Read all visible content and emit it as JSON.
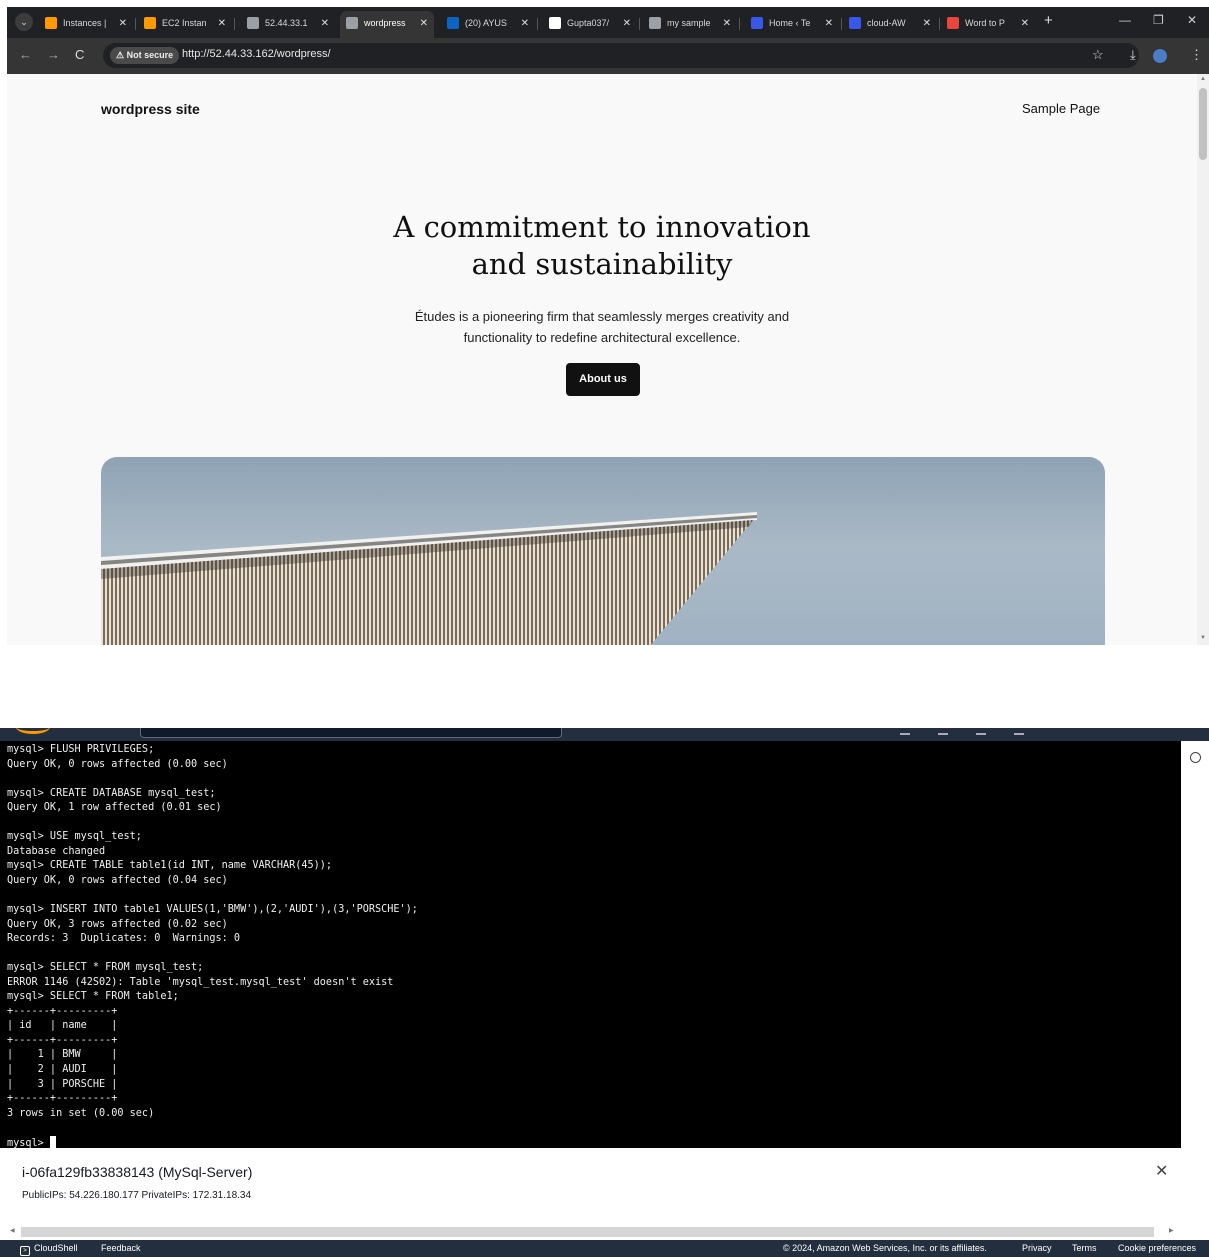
{
  "browser": {
    "tabs": [
      {
        "label": "Instances |",
        "color": "#ff9900",
        "active": false
      },
      {
        "label": "EC2 Instan",
        "color": "#ff9900",
        "active": false
      },
      {
        "label": "52.44.33.1",
        "color": "#9aa0a6",
        "active": false
      },
      {
        "label": "wordpress",
        "color": "#9aa0a6",
        "active": true
      },
      {
        "label": "(20) AYUS",
        "color": "#0a66c2",
        "active": false
      },
      {
        "label": "Gupta037/",
        "color": "#ffffff",
        "active": false
      },
      {
        "label": "my sample",
        "color": "#9aa0a6",
        "active": false
      },
      {
        "label": "Home ‹ Te",
        "color": "#3858e9",
        "active": false
      },
      {
        "label": "cloud-AW",
        "color": "#3858e9",
        "active": false
      },
      {
        "label": "Word to P",
        "color": "#e8453c",
        "active": false
      }
    ],
    "not_secure_label": "Not secure",
    "url": "http://52.44.33.162/wordpress/"
  },
  "site": {
    "title": "wordpress site",
    "nav_item": "Sample Page",
    "hero_line1": "A commitment to innovation",
    "hero_line2": "and sustainability",
    "desc_line1": "Études is a pioneering firm that seamlessly merges creativity and",
    "desc_line2": "functionality to redefine architectural excellence.",
    "button_label": "About us"
  },
  "terminal": {
    "lines": [
      "mysql> FLUSH PRIVILEGES;",
      "Query OK, 0 rows affected (0.00 sec)",
      "",
      "mysql> CREATE DATABASE mysql_test;",
      "Query OK, 1 row affected (0.01 sec)",
      "",
      "mysql> USE mysql_test;",
      "Database changed",
      "mysql> CREATE TABLE table1(id INT, name VARCHAR(45));",
      "Query OK, 0 rows affected (0.04 sec)",
      "",
      "mysql> INSERT INTO table1 VALUES(1,'BMW'),(2,'AUDI'),(3,'PORSCHE');",
      "Query OK, 3 rows affected (0.02 sec)",
      "Records: 3  Duplicates: 0  Warnings: 0",
      "",
      "mysql> SELECT * FROM mysql_test;",
      "ERROR 1146 (42S02): Table 'mysql_test.mysql_test' doesn't exist",
      "mysql> SELECT * FROM table1;",
      "+------+---------+",
      "| id   | name    |",
      "+------+---------+",
      "|    1 | BMW     |",
      "|    2 | AUDI    |",
      "|    3 | PORSCHE |",
      "+------+---------+",
      "3 rows in set (0.00 sec)",
      ""
    ],
    "prompt": "mysql> "
  },
  "instance": {
    "title": "i-06fa129fb33838143 (MySql-Server)",
    "ips": "PublicIPs: 54.226.180.177    PrivateIPs: 172.31.18.34"
  },
  "footer": {
    "cloudshell": "CloudShell",
    "feedback": "Feedback",
    "copyright": "© 2024, Amazon Web Services, Inc. or its affiliates.",
    "privacy": "Privacy",
    "terms": "Terms",
    "cookie": "Cookie preferences"
  }
}
